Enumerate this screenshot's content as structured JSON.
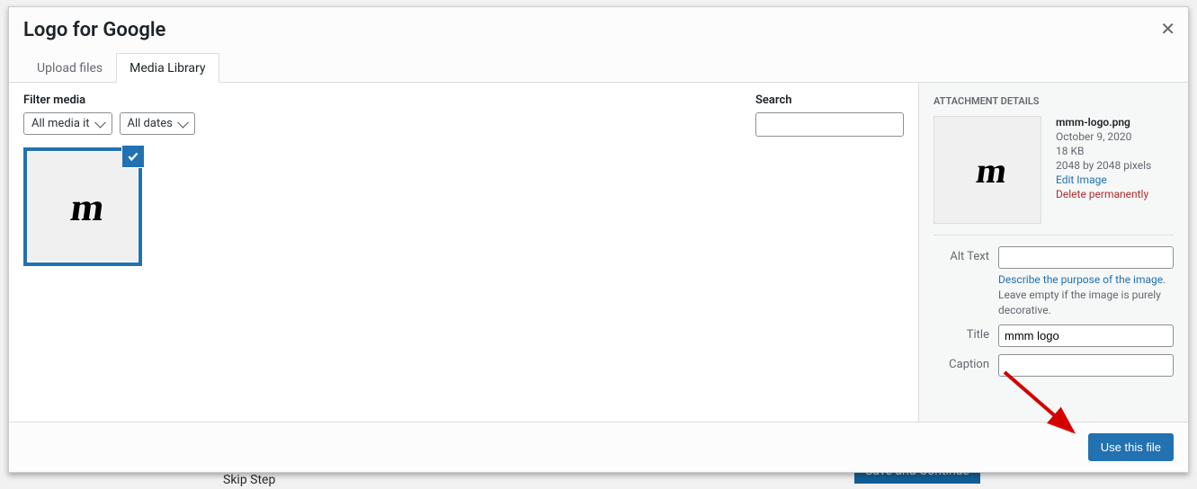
{
  "bg": {
    "skip": "Skip Step",
    "save": "Save and Continue"
  },
  "modal": {
    "title": "Logo for Google",
    "tabs": {
      "upload": "Upload files",
      "library": "Media Library"
    },
    "filter_label": "Filter media",
    "filter_type": "All media it",
    "filter_date": "All dates",
    "search_label": "Search",
    "use_button": "Use this file"
  },
  "details": {
    "heading": "ATTACHMENT DETAILS",
    "filename": "mmm-logo.png",
    "date": "October 9, 2020",
    "size": "18 KB",
    "dimensions": "2048 by 2048 pixels",
    "edit": "Edit Image",
    "delete": "Delete permanently",
    "alt_label": "Alt Text",
    "alt_value": "",
    "help_link": "Describe the purpose of the image",
    "help_rest": ". Leave empty if the image is purely decorative.",
    "title_label": "Title",
    "title_value": "mmm logo",
    "caption_label": "Caption"
  }
}
